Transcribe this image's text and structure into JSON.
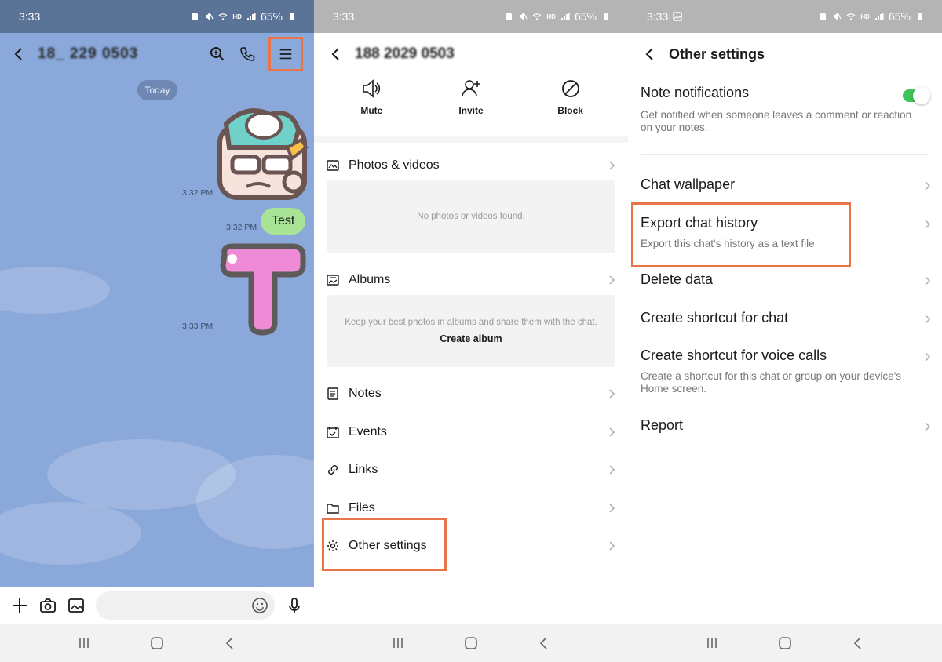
{
  "colors": {
    "highlight": "#e8754a",
    "chat_bg": "#8aa8d9",
    "bubble": "#a8e396",
    "toggle_on": "#3dc45a"
  },
  "panel1": {
    "status": {
      "time": "3:33",
      "battery": "65%",
      "hd": "HD"
    },
    "header": {
      "contact": "18_ 229 0503"
    },
    "date_chip": "Today",
    "messages": [
      {
        "type": "sticker",
        "time": "3:32 PM"
      },
      {
        "type": "text",
        "text": "Test",
        "time": "3:32 PM"
      },
      {
        "type": "sticker",
        "time": "3:33 PM"
      }
    ],
    "icons": [
      "back-icon",
      "search-icon",
      "phone-icon",
      "menu-icon",
      "plus-icon",
      "camera-icon",
      "image-icon",
      "emoji-icon",
      "mic-icon"
    ]
  },
  "panel2": {
    "status": {
      "time": "3:33",
      "battery": "65%",
      "hd": "HD"
    },
    "header": {
      "contact": "188 2029 0503"
    },
    "actions": [
      {
        "label": "Mute",
        "icon": "speaker-icon"
      },
      {
        "label": "Invite",
        "icon": "add-person-icon"
      },
      {
        "label": "Block",
        "icon": "block-icon"
      }
    ],
    "photos_videos": {
      "label": "Photos & videos",
      "empty": "No photos or videos found."
    },
    "albums": {
      "label": "Albums",
      "empty": "Keep your best photos in albums and share them with the chat.",
      "create": "Create album"
    },
    "list": [
      {
        "label": "Notes",
        "icon": "notes-icon"
      },
      {
        "label": "Events",
        "icon": "calendar-icon"
      },
      {
        "label": "Links",
        "icon": "link-icon"
      },
      {
        "label": "Files",
        "icon": "folder-icon"
      },
      {
        "label": "Other settings",
        "icon": "gear-icon"
      }
    ]
  },
  "panel3": {
    "status": {
      "time": "3:33",
      "battery": "65%",
      "hd": "HD"
    },
    "header": {
      "title": "Other settings"
    },
    "note_notifications": {
      "title": "Note notifications",
      "subtitle": "Get notified when someone leaves a comment or reaction on your notes.",
      "enabled": true
    },
    "items": [
      {
        "title": "Chat wallpaper",
        "subtitle": ""
      },
      {
        "title": "Export chat history",
        "subtitle": "Export this chat's history as a text file."
      },
      {
        "title": "Delete data",
        "subtitle": ""
      },
      {
        "title": "Create shortcut for chat",
        "subtitle": ""
      },
      {
        "title": "Create shortcut for voice calls",
        "subtitle": "Create a shortcut for this chat or group on your device's Home screen."
      },
      {
        "title": "Report",
        "subtitle": ""
      }
    ]
  }
}
